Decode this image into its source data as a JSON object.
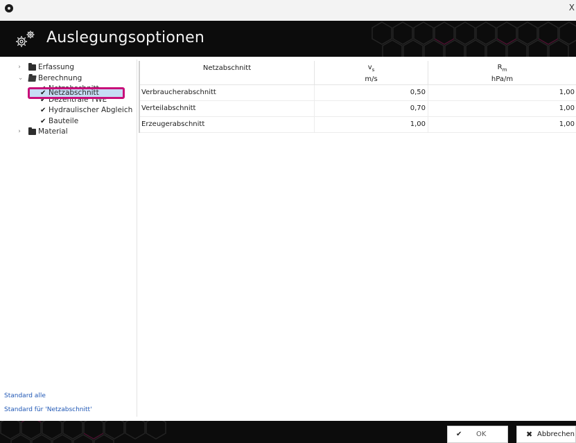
{
  "window": {
    "close_glyph": "X"
  },
  "header": {
    "title": "Auslegungsoptionen",
    "icon": "gear-icon"
  },
  "tree": {
    "items": [
      {
        "label": "Erfassung",
        "icon": "folder-icon",
        "expanded": false
      },
      {
        "label": "Berechnung",
        "icon": "folder-open-icon",
        "expanded": true,
        "children": [
          {
            "label": "Netzabschnitt",
            "selected": true
          },
          {
            "label": "Dezentrale TWE"
          },
          {
            "label": "Hydraulischer Abgleich"
          },
          {
            "label": "Bauteile"
          }
        ]
      },
      {
        "label": "Material",
        "icon": "folder-icon",
        "expanded": false
      }
    ]
  },
  "links": {
    "standard_all": "Standard alle",
    "standard_current": "Standard für 'Netzabschnitt'"
  },
  "table": {
    "headers": [
      {
        "label": "Netzabschnitt"
      },
      {
        "label": "v",
        "sub": "s",
        "unit": "m/s"
      },
      {
        "label": "R",
        "sub": "m",
        "unit": "hPa/m"
      }
    ],
    "rows": [
      {
        "name": "Verbraucherabschnitt",
        "v": "0,50",
        "r": "1,00"
      },
      {
        "name": "Verteilabschnitt",
        "v": "0,70",
        "r": "1,00"
      },
      {
        "name": "Erzeugerabschnitt",
        "v": "1,00",
        "r": "1,00"
      }
    ]
  },
  "buttons": {
    "ok": "OK",
    "cancel": "Abbrechen"
  },
  "colors": {
    "accent_highlight": "#c8107a",
    "selection_bg": "#c6dcf4",
    "link": "#1f57b5",
    "header_bg": "#0c0c0c"
  }
}
